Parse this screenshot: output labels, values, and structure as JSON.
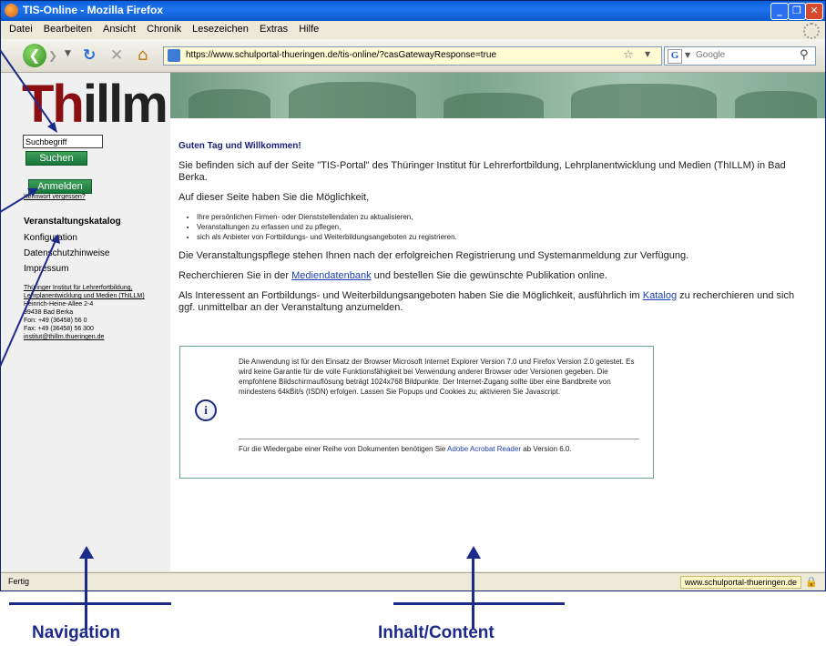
{
  "window": {
    "title": "TIS-Online - Mozilla Firefox"
  },
  "menu": {
    "items": [
      "Datei",
      "Bearbeiten",
      "Ansicht",
      "Chronik",
      "Lesezeichen",
      "Extras",
      "Hilfe"
    ]
  },
  "toolbar": {
    "url": "https://www.schulportal-thueringen.de/tis-online/?casGatewayResponse=true",
    "search_placeholder": "Google"
  },
  "sidebar": {
    "logo_th": "Th",
    "logo_rest": "illm",
    "search_value": "Suchbegriff",
    "search_button": "Suchen",
    "login_button": "Anmelden",
    "forgot_password": "Kennwort vergessen?",
    "nav": [
      "Veranstaltungskatalog",
      "Konfiguration",
      "Datenschutzhinweise",
      "Impressum"
    ],
    "address": {
      "org": "Thüringer Institut für Lehrerfortbildung, Lehrplanentwicklung und Medien (ThILLM)",
      "street": "Heinrich-Heine-Allee 2-4",
      "city": "99438 Bad Berka",
      "phone": "Fon: +49 (36458) 56 0",
      "fax": "Fax: +49 (36458) 56 300",
      "email": "institut@thillm.thueringen.de"
    }
  },
  "main": {
    "greeting": "Guten Tag und Willkommen!",
    "intro": "Sie befinden sich auf der Seite \"TIS-Portal\" des Thüringer Institut für Lehrerfortbildung, Lehrplanentwicklung und Medien (ThILLM) in Bad Berka.",
    "possibility": "Auf dieser Seite haben Sie die Möglichkeit,",
    "bullets": [
      "Ihre persönlichen Firmen- oder Dienststellendaten zu aktualisieren,",
      "Veranstaltungen zu erfassen und zu pflegen,",
      "sich als Anbieter von Fortbildungs- und Weiterbildungsangeboten zu registrieren."
    ],
    "availability": "Die Veranstaltungspflege stehen Ihnen nach der erfolgreichen Registrierung und Systemanmeldung zur Verfügung.",
    "research_pre": "Recherchieren Sie in der ",
    "research_link": "Mediendatenbank",
    "research_post": " und bestellen Sie die gewünschte Publikation online.",
    "interest_pre": "Als Interessent an Fortbildungs- und Weiterbildungsangeboten haben Sie die Möglichkeit, ausführlich im ",
    "interest_link": "Katalog",
    "interest_post": " zu recherchieren und sich ggf. unmittelbar an der Veranstaltung anzumelden.",
    "info_text": "Die Anwendung ist für den Einsatz der Browser Microsoft Internet Explorer Version 7.0 und Firefox Version 2.0 getestet. Es wird keine Garantie für die volle Funktionsfähigkeit bei Verwendung anderer Browser oder Versionen gegeben. Die empfohlene Bildschirmauflösung beträgt 1024x768 Bildpunkte. Der Internet-Zugang sollte über eine Bandbreite von mindestens 64kBit/s (ISDN) erfolgen. Lassen Sie Popups und Cookies zu; aktivieren Sie Javascript.",
    "acrobat_pre": "Für die Wiedergabe einer Reihe von Dokumenten benötigen Sie ",
    "acrobat_link": "Adobe Acrobat Reader",
    "acrobat_post": " ab Version 6.0."
  },
  "status": {
    "text": "Fertig",
    "host": "www.schulportal-thueringen.de"
  },
  "annotations": {
    "navigation": "Navigation",
    "content": "Inhalt/Content"
  },
  "colors": {
    "logo_red": "#8b0f12",
    "button_green": "#17753a",
    "greeting_blue": "#1b1f7a",
    "annotation_blue": "#1c2a8a"
  }
}
